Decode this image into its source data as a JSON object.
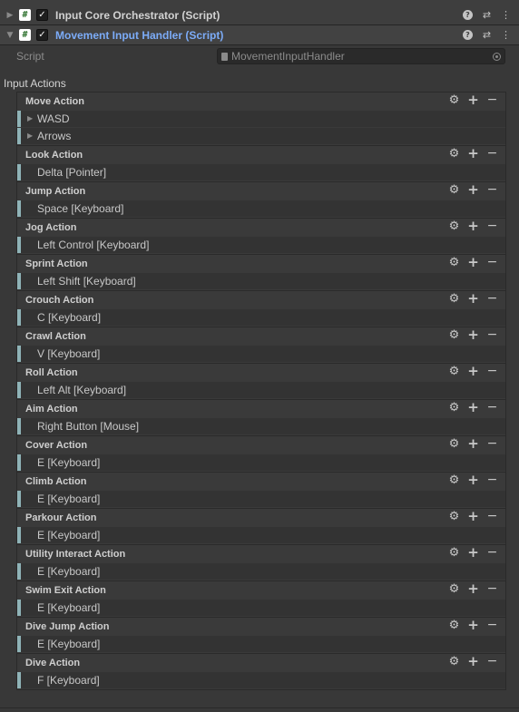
{
  "components": [
    {
      "title": "Input Core Orchestrator (Script)",
      "expanded": false,
      "enabled": true,
      "selected": false
    },
    {
      "title": "Movement Input Handler (Script)",
      "expanded": true,
      "enabled": true,
      "selected": true
    }
  ],
  "script_field": {
    "label": "Script",
    "value": "MovementInputHandler"
  },
  "section_title": "Input Actions",
  "actions": [
    {
      "title": "Move Action",
      "bindings": [
        "WASD",
        "Arrows"
      ],
      "composite": true
    },
    {
      "title": "Look Action",
      "bindings": [
        "Delta [Pointer]"
      ]
    },
    {
      "title": "Jump Action",
      "bindings": [
        "Space [Keyboard]"
      ]
    },
    {
      "title": "Jog Action",
      "bindings": [
        "Left Control [Keyboard]"
      ]
    },
    {
      "title": "Sprint Action",
      "bindings": [
        "Left Shift [Keyboard]"
      ]
    },
    {
      "title": "Crouch Action",
      "bindings": [
        "C [Keyboard]"
      ]
    },
    {
      "title": "Crawl Action",
      "bindings": [
        "V [Keyboard]"
      ]
    },
    {
      "title": "Roll Action",
      "bindings": [
        "Left Alt [Keyboard]"
      ]
    },
    {
      "title": "Aim Action",
      "bindings": [
        "Right Button [Mouse]"
      ]
    },
    {
      "title": "Cover Action",
      "bindings": [
        "E [Keyboard]"
      ]
    },
    {
      "title": "Climb Action",
      "bindings": [
        "E [Keyboard]"
      ]
    },
    {
      "title": "Parkour Action",
      "bindings": [
        "E [Keyboard]"
      ]
    },
    {
      "title": "Utility Interact Action",
      "bindings": [
        "E [Keyboard]"
      ]
    },
    {
      "title": "Swim Exit Action",
      "bindings": [
        "E [Keyboard]"
      ]
    },
    {
      "title": "Dive Jump Action",
      "bindings": [
        "E [Keyboard]"
      ]
    },
    {
      "title": "Dive Action",
      "bindings": [
        "F [Keyboard]"
      ]
    }
  ],
  "colors": {
    "background": "#383838",
    "selected_title": "#7cacf8",
    "binding_bar": "#8fb3b7"
  },
  "icons": {
    "help": "help-icon",
    "presets": "presets-icon",
    "menu": "kebab-menu-icon",
    "gear": "gear-icon",
    "add": "add-binding-icon",
    "remove": "remove-icon"
  }
}
